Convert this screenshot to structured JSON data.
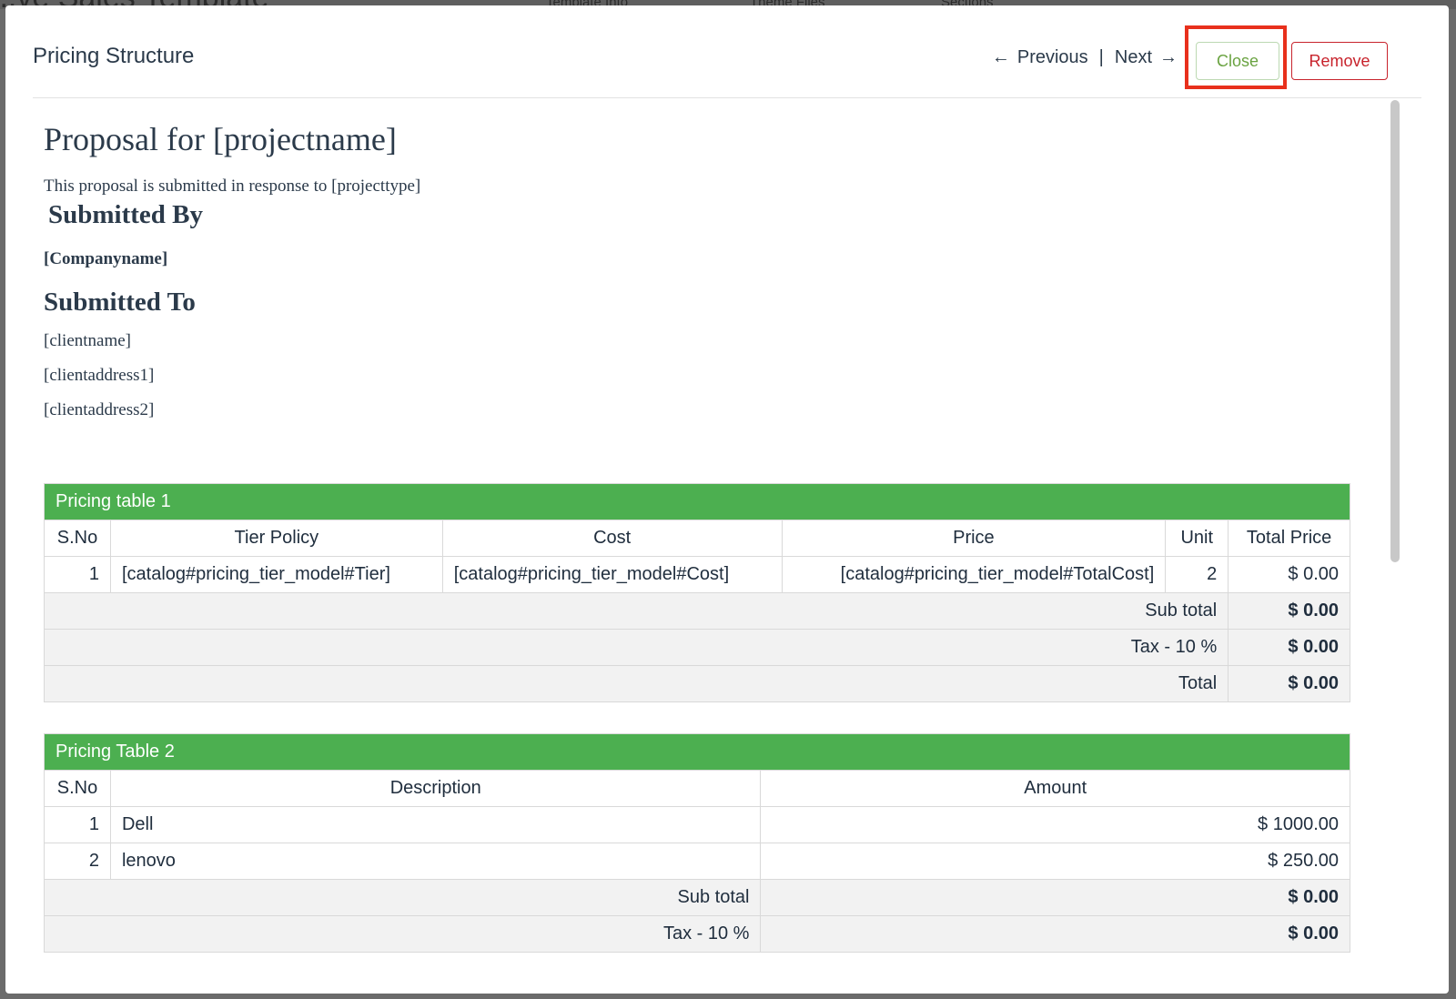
{
  "background": {
    "title_fragment": "...ve Sales Template",
    "tabs": [
      "Template Info",
      "Theme Files",
      "Sections"
    ]
  },
  "modal": {
    "title": "Pricing Structure",
    "nav": {
      "previous": "Previous",
      "separator": "|",
      "next": "Next"
    },
    "close_label": "Close",
    "remove_label": "Remove"
  },
  "colors": {
    "accent_green": "#4caf50",
    "close_green": "#6aa341",
    "remove_red": "#c8232c",
    "highlight_red": "#e8301c"
  },
  "doc": {
    "title": "Proposal for [projectname]",
    "intro": "This proposal is submitted in response to [projecttype]",
    "submitted_by_heading": "Submitted By",
    "company": "[Companyname]",
    "submitted_to_heading": "Submitted To",
    "client_lines": [
      "[clientname]",
      "[clientaddress1]",
      "[clientaddress2]"
    ]
  },
  "table1": {
    "title": "Pricing table 1",
    "headers": [
      "S.No",
      "Tier Policy",
      "Cost",
      "Price",
      "Unit",
      "Total Price"
    ],
    "rows": [
      [
        "1",
        "[catalog#pricing_tier_model#Tier]",
        "[catalog#pricing_tier_model#Cost]",
        "[catalog#pricing_tier_model#TotalCost]",
        "2",
        "$ 0.00"
      ]
    ],
    "summary": [
      {
        "label": "Sub total",
        "value": "$ 0.00"
      },
      {
        "label": "Tax - 10 %",
        "value": "$ 0.00"
      },
      {
        "label": "Total",
        "value": "$ 0.00"
      }
    ]
  },
  "table2": {
    "title": "Pricing Table 2",
    "headers": [
      "S.No",
      "Description",
      "Amount"
    ],
    "rows": [
      [
        "1",
        "Dell",
        "$ 1000.00"
      ],
      [
        "2",
        "lenovo",
        "$ 250.00"
      ]
    ],
    "summary": [
      {
        "label": "Sub total",
        "value": "$ 0.00"
      },
      {
        "label": "Tax - 10 %",
        "value": "$ 0.00"
      }
    ]
  }
}
